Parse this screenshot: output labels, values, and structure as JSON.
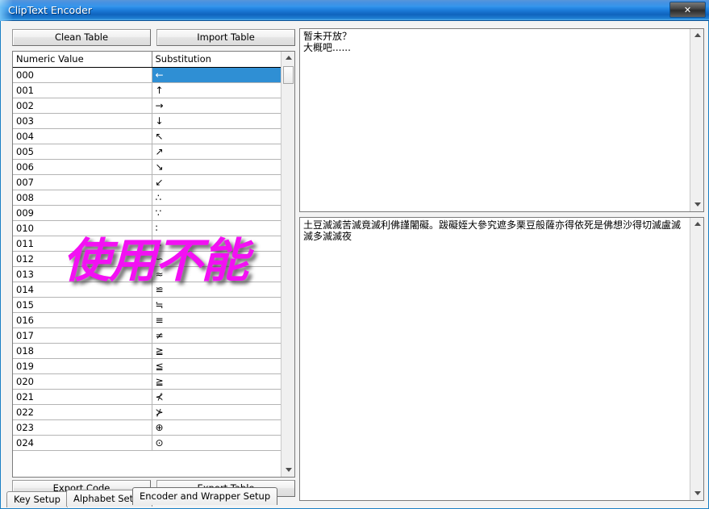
{
  "window": {
    "title": "ClipText Encoder",
    "close_label": "✕",
    "close_icon": "close-icon"
  },
  "toolbar": {
    "clean_table": "Clean Table",
    "import_table": "Import Table"
  },
  "footer": {
    "export_code": "Export Code",
    "export_table": "Export Table"
  },
  "grid": {
    "columns": [
      "Numeric Value",
      "Substitution"
    ],
    "selected_row_index": 0,
    "rows": [
      {
        "num": "000",
        "sub": "←"
      },
      {
        "num": "001",
        "sub": "↑"
      },
      {
        "num": "002",
        "sub": "→"
      },
      {
        "num": "003",
        "sub": "↓"
      },
      {
        "num": "004",
        "sub": "↖"
      },
      {
        "num": "005",
        "sub": "↗"
      },
      {
        "num": "006",
        "sub": "↘"
      },
      {
        "num": "007",
        "sub": "↙"
      },
      {
        "num": "008",
        "sub": "∴"
      },
      {
        "num": "009",
        "sub": "∵"
      },
      {
        "num": "010",
        "sub": "∶"
      },
      {
        "num": "011",
        "sub": "∷"
      },
      {
        "num": "012",
        "sub": "∽"
      },
      {
        "num": "013",
        "sub": "≈"
      },
      {
        "num": "014",
        "sub": "≌"
      },
      {
        "num": "015",
        "sub": "≒"
      },
      {
        "num": "016",
        "sub": "≡"
      },
      {
        "num": "017",
        "sub": "≠"
      },
      {
        "num": "018",
        "sub": "≧"
      },
      {
        "num": "019",
        "sub": "≦"
      },
      {
        "num": "020",
        "sub": "≧"
      },
      {
        "num": "021",
        "sub": "⊀"
      },
      {
        "num": "022",
        "sub": "⊁"
      },
      {
        "num": "023",
        "sub": "⊕"
      },
      {
        "num": "024",
        "sub": "⊙"
      }
    ]
  },
  "panels": {
    "top_text": "暂未开放？\n大概吧......",
    "bottom_text": "土豆滅滅苦滅竟滅利佛謹闍礙。跋礙姪大參究遮多栗豆般薩亦得依死是佛想沙得切滅盧滅滅多滅滅夜"
  },
  "tabs": [
    {
      "label": "Key Setup",
      "active": false
    },
    {
      "label": "Alphabet Setup",
      "active": false
    },
    {
      "label": "Encoder and Wrapper Setup",
      "active": true
    }
  ],
  "watermark": {
    "text": "使用不能",
    "color": "#f310f3"
  },
  "scrollbars": {
    "up_arrow": "scroll-up-icon",
    "down_arrow": "scroll-down-icon"
  }
}
